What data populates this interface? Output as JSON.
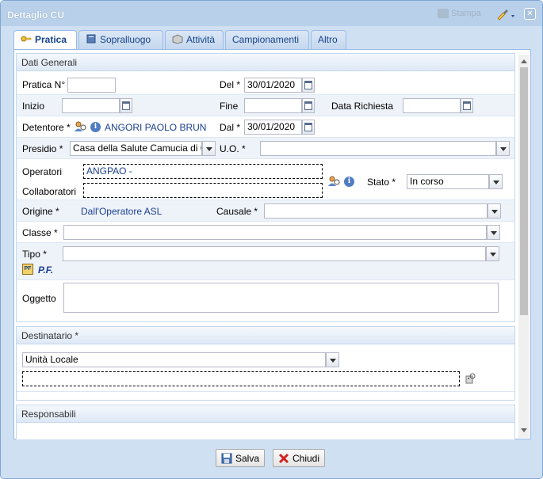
{
  "window": {
    "title": "Dettaglio CU",
    "print_label": "Stampa"
  },
  "tabs": [
    {
      "label": "Pratica",
      "icon": "key-icon"
    },
    {
      "label": "Sopralluogo",
      "icon": "book-icon"
    },
    {
      "label": "Attività",
      "icon": "box-icon"
    },
    {
      "label": "Campionamenti",
      "icon": ""
    },
    {
      "label": "Altro",
      "icon": ""
    }
  ],
  "dati_generali": {
    "header": "Dati Generali",
    "pratica_label": "Pratica N°",
    "pratica_value": "",
    "del_label": "Del *",
    "del_value": "30/01/2020",
    "inizio_label": "Inizio",
    "inizio_value": "",
    "fine_label": "Fine",
    "fine_value": "",
    "data_richiesta_label": "Data Richiesta",
    "data_richiesta_value": "",
    "detentore_label": "Detentore *",
    "detentore_value": "ANGORI PAOLO BRUN",
    "dal_label": "Dal *",
    "dal_value": "30/01/2020",
    "presidio_label": "Presidio *",
    "presidio_value": "Casa della Salute Camucia di C",
    "uo_label": "U.O. *",
    "uo_value": "",
    "operatori_label": "Operatori",
    "operatori_value": "ANGPAO -",
    "collaboratori_label": "Collaboratori",
    "collaboratori_value": "",
    "stato_label": "Stato *",
    "stato_value": "In corso",
    "origine_label": "Origine *",
    "origine_value": "Dall'Operatore ASL",
    "causale_label": "Causale *",
    "causale_value": "",
    "classe_label": "Classe *",
    "classe_value": "",
    "tipo_label": "Tipo *",
    "tipo_value": "",
    "pf_label": "P.F.",
    "oggetto_label": "Oggetto",
    "oggetto_value": ""
  },
  "destinatario": {
    "header": "Destinatario *",
    "select_value": "Unità Locale",
    "field_value": ""
  },
  "responsabili": {
    "header": "Responsabili"
  },
  "footer": {
    "save_label": "Salva",
    "close_label": "Chiudi"
  },
  "colors": {
    "link_blue": "#1b3f91",
    "tab_text": "#15428b",
    "header_bg": "#b9d0ea"
  }
}
